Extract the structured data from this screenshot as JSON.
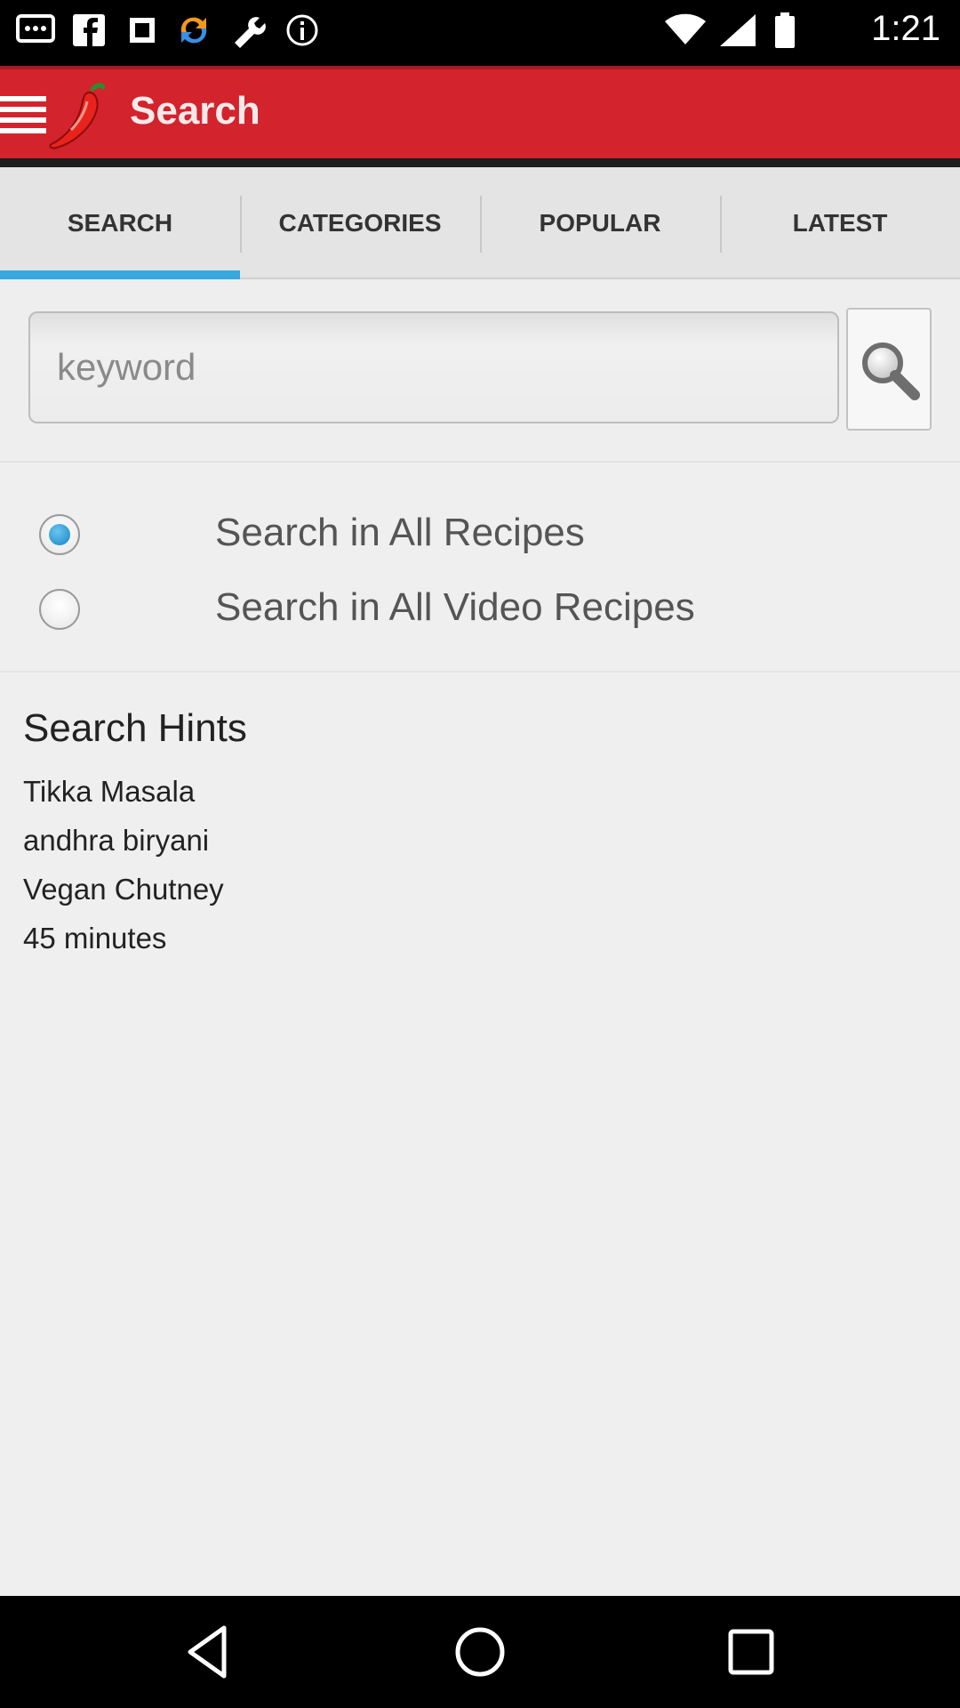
{
  "status_bar": {
    "time": "1:21",
    "icons": [
      "messages-icon",
      "facebook-icon",
      "settings-sync-icon",
      "wrench-icon",
      "info-icon"
    ]
  },
  "app_bar": {
    "title": "Search",
    "menu_icon": "menu-icon",
    "logo_icon": "chili-pepper-icon",
    "color": "#d3232c"
  },
  "tabs": [
    {
      "label": "SEARCH",
      "active": true
    },
    {
      "label": "CATEGORIES",
      "active": false
    },
    {
      "label": "POPULAR",
      "active": false
    },
    {
      "label": "LATEST",
      "active": false
    }
  ],
  "search": {
    "placeholder": "keyword",
    "value": "",
    "button_icon": "search-icon"
  },
  "search_options": [
    {
      "label": "Search in All Recipes",
      "checked": true
    },
    {
      "label": "Search in All Video Recipes",
      "checked": false
    }
  ],
  "hints": {
    "title": "Search Hints",
    "items": [
      "Tikka Masala",
      "andhra biryani",
      "Vegan Chutney",
      "45 minutes"
    ]
  },
  "nav_bar": {
    "buttons": [
      "back-icon",
      "home-icon",
      "recents-icon"
    ]
  },
  "colors": {
    "accent": "#d3232c",
    "tab_indicator": "#35a8e0",
    "radio_selected": "#1583c4"
  }
}
